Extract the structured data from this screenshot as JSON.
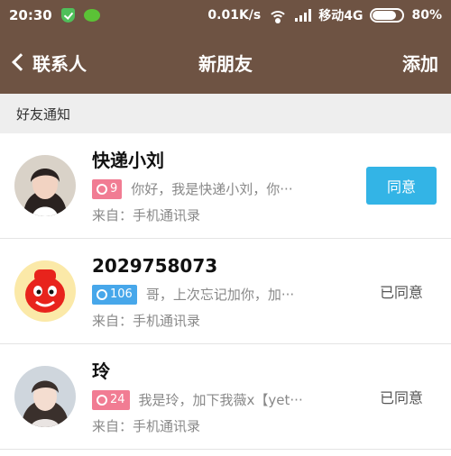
{
  "statusbar": {
    "time": "20:30",
    "speed": "0.01K/s",
    "carrier": "移动4G",
    "battery": "80%",
    "battery_level": 0.8
  },
  "navbar": {
    "back_label": "联系人",
    "title": "新朋友",
    "add_label": "添加"
  },
  "section": {
    "title": "好友通知"
  },
  "requests": [
    {
      "name": "快递小刘",
      "badge": "9",
      "badge_color": "#f17c93",
      "message": "你好，我是快递小刘，你···",
      "source": "来自：手机通讯录",
      "action": "同意",
      "avatar": "female-photo-avatar"
    },
    {
      "name": "2029758073",
      "badge": "106",
      "badge_color": "#47a7ea",
      "message": "哥，上次忘记加你，加···",
      "source": "来自：手机通讯录",
      "status": "已同意",
      "avatar": "red-mascot-avatar"
    },
    {
      "name": "玲",
      "badge": "24",
      "badge_color": "#f17c93",
      "message": "我是玲，加下我薇x【yet···",
      "source": "来自：手机通讯录",
      "status": "已同意",
      "avatar": "female-photo-avatar"
    }
  ]
}
